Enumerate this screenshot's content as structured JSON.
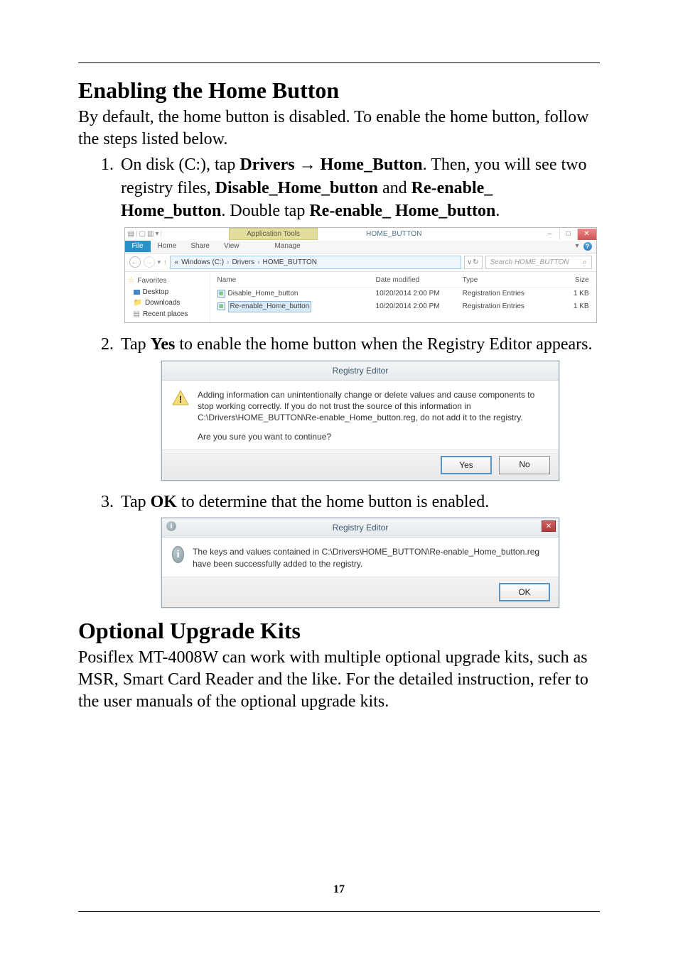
{
  "section1": {
    "title": "Enabling the Home Button",
    "intro": "By default, the home button is disabled. To enable the home button, follow the steps listed below.",
    "step1": {
      "prefix": "On disk (C:), tap ",
      "b1": "Drivers",
      "arrow": " → ",
      "b2": "Home_Button",
      "mid1": ". Then, you will see two registry files, ",
      "b3": "Disable_Home_button",
      "mid2": " and ",
      "b4": "Re-enable_ Home_button",
      "mid3": ". Double tap ",
      "b5": "Re-enable_ Home_button",
      "end": "."
    },
    "step2": {
      "prefix": "Tap ",
      "b1": "Yes",
      "rest": " to enable the home button when the Registry Editor appears."
    },
    "step3": {
      "prefix": "Tap ",
      "b1": "OK",
      "rest": " to determine that the home button is enabled."
    }
  },
  "explorer": {
    "app_tools": "Application Tools",
    "window_title": "HOME_BUTTON",
    "tabs": {
      "file": "File",
      "home": "Home",
      "share": "Share",
      "view": "View",
      "manage": "Manage"
    },
    "breadcrumb": {
      "pre": "«",
      "p1": "Windows (C:)",
      "p2": "Drivers",
      "p3": "HOME_BUTTON"
    },
    "refresh_caret": "v",
    "search_placeholder": "Search HOME_BUTTON",
    "tree": {
      "favorites": "Favorites",
      "desktop": "Desktop",
      "downloads": "Downloads",
      "recent": "Recent places"
    },
    "cols": {
      "name": "Name",
      "date": "Date modified",
      "type": "Type",
      "size": "Size"
    },
    "rows": [
      {
        "name": "Disable_Home_button",
        "date": "10/20/2014 2:00 PM",
        "type": "Registration Entries",
        "size": "1 KB"
      },
      {
        "name": "Re-enable_Home_button",
        "date": "10/20/2014 2:00 PM",
        "type": "Registration Entries",
        "size": "1 KB"
      }
    ]
  },
  "dialog1": {
    "title": "Registry Editor",
    "msg": "Adding information can unintentionally change or delete values and cause components to stop working correctly. If you do not trust the source of this information in C:\\Drivers\\HOME_BUTTON\\Re-enable_Home_button.reg, do not add it to the registry.",
    "q": "Are you sure you want to continue?",
    "yes": "Yes",
    "no": "No"
  },
  "dialog2": {
    "title": "Registry Editor",
    "msg": "The keys and values contained in C:\\Drivers\\HOME_BUTTON\\Re-enable_Home_button.reg have been successfully added to the registry.",
    "ok": "OK"
  },
  "section2": {
    "title": "Optional Upgrade Kits",
    "body": "Posiflex MT-4008W can work with multiple optional upgrade kits, such as MSR, Smart Card Reader and the like. For the detailed instruction, refer to the user manuals of the optional upgrade kits."
  },
  "page_number": "17",
  "icons": {
    "info_glyph": "i",
    "warn_glyph": "!",
    "close_glyph": "✕",
    "min_glyph": "–",
    "max_glyph": "□",
    "search_glyph": "⌕",
    "refresh_glyph": "↻",
    "chev": "›",
    "caret_down": "▾",
    "up_arrow": "↑",
    "star": "☆"
  }
}
